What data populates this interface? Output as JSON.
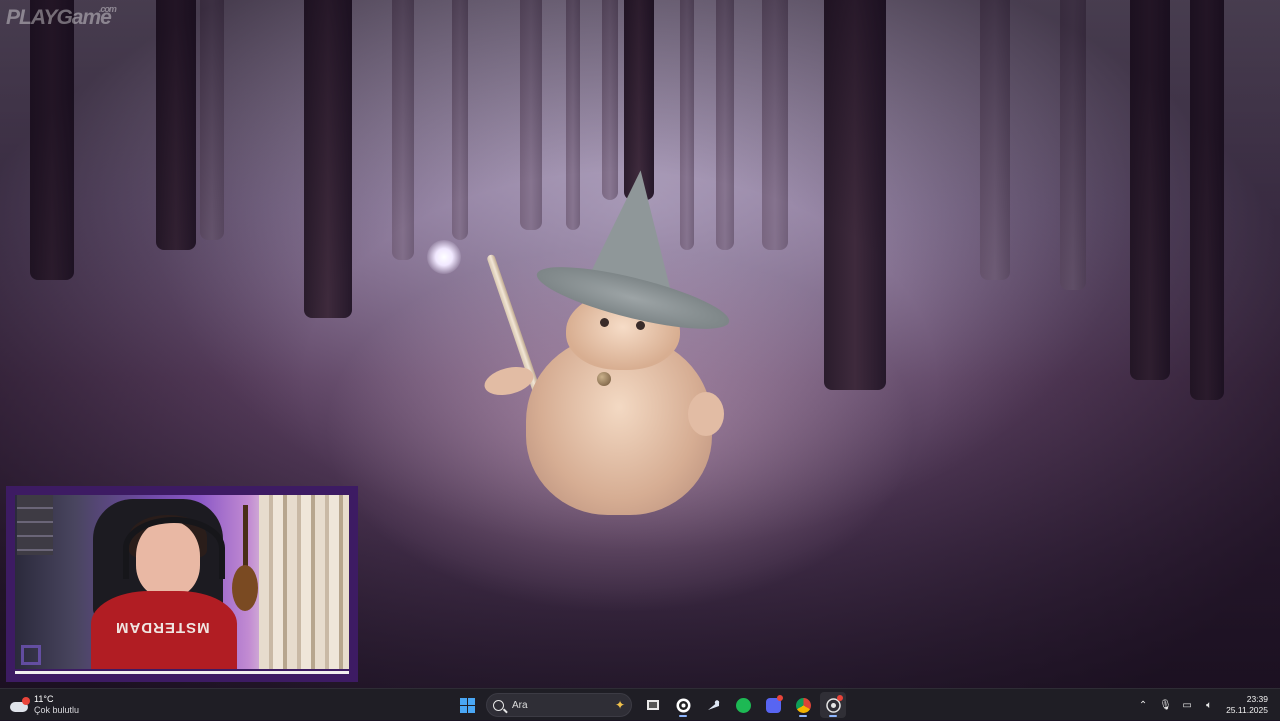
{
  "watermark": {
    "brand": "PLAYGame",
    "suffix": ".com"
  },
  "webcam": {
    "shirt_text": "MSTERDAM"
  },
  "taskbar": {
    "weather": {
      "temperature": "11°C",
      "condition": "Çok bulutlu"
    },
    "search": {
      "label": "Ara"
    },
    "apps": [
      "windows-start",
      "search",
      "task-view",
      "obs-studio",
      "steam",
      "spotify",
      "discord",
      "chrome",
      "obs-recording"
    ],
    "clock": {
      "time": "23:39",
      "date": "25.11.2025"
    }
  },
  "colors": {
    "webcam_frame": "#3d1b63",
    "taskbar_bg": "#1f1e25",
    "accent": "#4aa7f5"
  }
}
